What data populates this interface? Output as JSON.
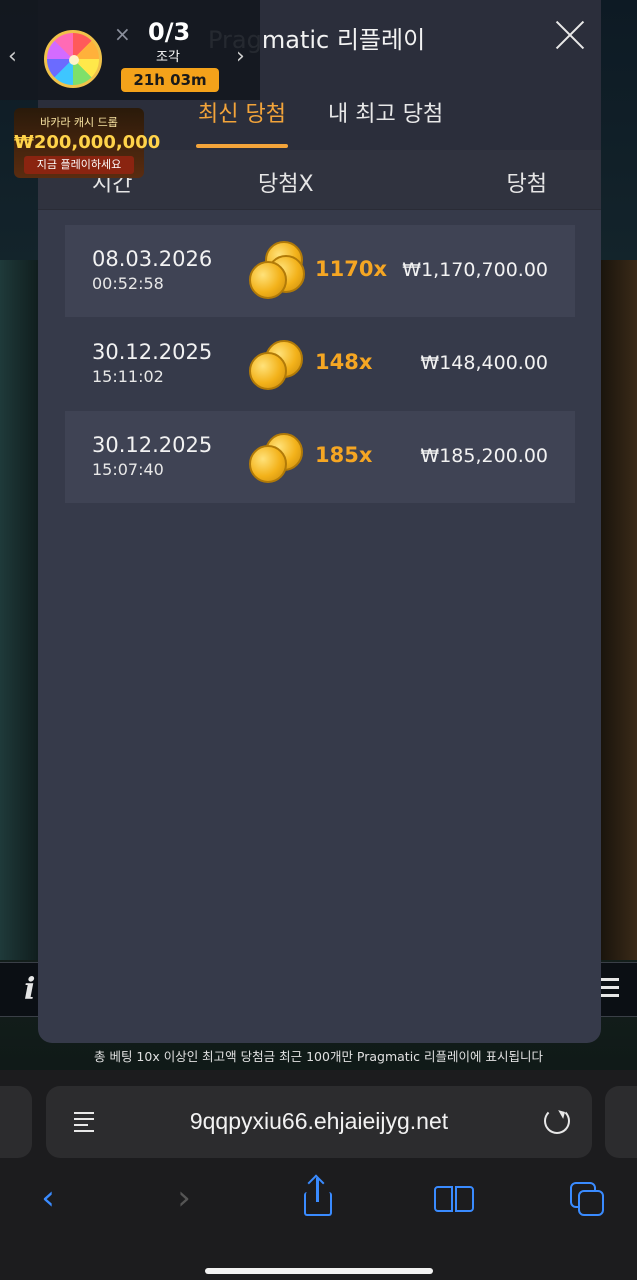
{
  "modal": {
    "title": "Pragmatic 리플레이",
    "tabs": [
      {
        "label": "최신 당첨",
        "active": true
      },
      {
        "label": "내 최고 당첨",
        "active": false
      }
    ],
    "columns": {
      "time": "시간",
      "multiplier": "당첨X",
      "win": "당첨"
    },
    "rows": [
      {
        "date": "08.03.2026",
        "time": "00:52:58",
        "multiplier": "1170x",
        "amount": "₩1,170,700.00"
      },
      {
        "date": "30.12.2025",
        "time": "15:11:02",
        "multiplier": "148x",
        "amount": "₩148,400.00"
      },
      {
        "date": "30.12.2025",
        "time": "15:07:40",
        "multiplier": "185x",
        "amount": "₩185,200.00"
      }
    ],
    "footer_note": "총 베팅 10x 이상인 최고액 당첨금 최근 100개만 Pragmatic 리플레이에 표시됩니다",
    "accent_color": "#f3a43a"
  },
  "promo": {
    "piece_count": "0/3",
    "piece_label": "조각",
    "timer": "21h 03m",
    "banner_title": "바카라 캐시 드롭",
    "banner_amount": "₩200,000,000",
    "banner_cta": "지금 플레이하세요"
  },
  "browser": {
    "url": "9qqpyxiu66.ehjaieijyg.net"
  },
  "game": {
    "info_label": "i"
  }
}
